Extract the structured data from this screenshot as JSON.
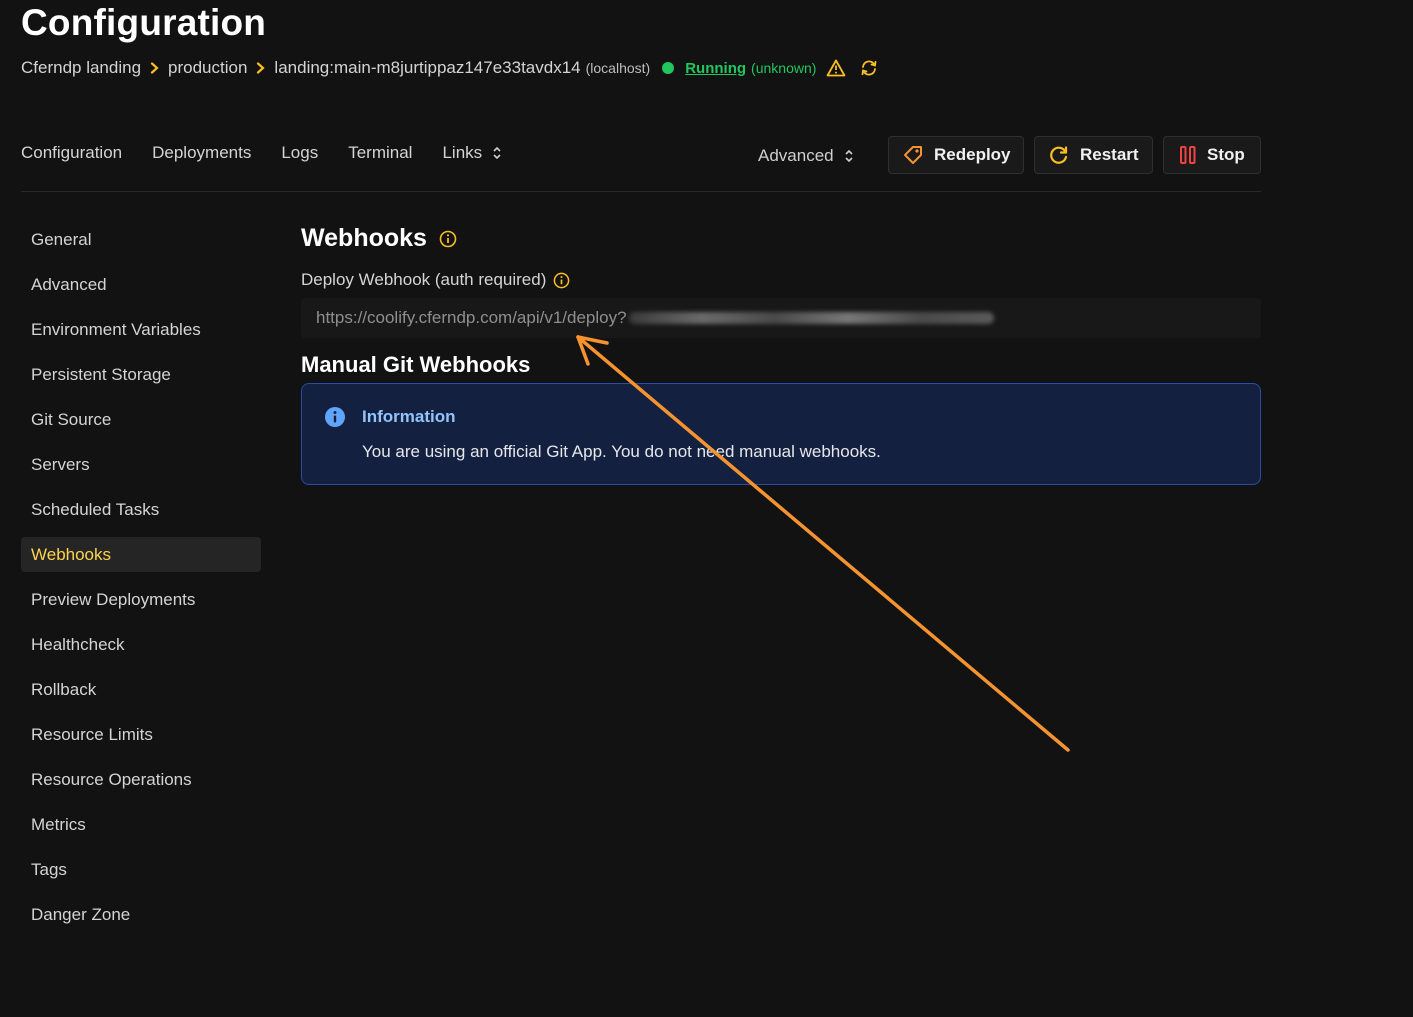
{
  "page": {
    "title": "Configuration"
  },
  "breadcrumb": {
    "project": "Cferndp landing",
    "environment": "production",
    "resource": "landing:main-m8jurtippaz147e33tavdx14",
    "server": "(localhost)",
    "status": "Running",
    "health": "(unknown)"
  },
  "tabs": {
    "configuration": "Configuration",
    "deployments": "Deployments",
    "logs": "Logs",
    "terminal": "Terminal",
    "links": "Links"
  },
  "actions": {
    "advanced": "Advanced",
    "redeploy": "Redeploy",
    "restart": "Restart",
    "stop": "Stop"
  },
  "sidebar": {
    "items": [
      {
        "label": "General"
      },
      {
        "label": "Advanced"
      },
      {
        "label": "Environment Variables"
      },
      {
        "label": "Persistent Storage"
      },
      {
        "label": "Git Source"
      },
      {
        "label": "Servers"
      },
      {
        "label": "Scheduled Tasks"
      },
      {
        "label": "Webhooks",
        "active": true
      },
      {
        "label": "Preview Deployments"
      },
      {
        "label": "Healthcheck"
      },
      {
        "label": "Rollback"
      },
      {
        "label": "Resource Limits"
      },
      {
        "label": "Resource Operations"
      },
      {
        "label": "Metrics"
      },
      {
        "label": "Tags"
      },
      {
        "label": "Danger Zone"
      }
    ]
  },
  "main": {
    "webhooks_title": "Webhooks",
    "deploy_webhook_label": "Deploy Webhook (auth required)",
    "deploy_webhook_url": "https://coolify.cferndp.com/api/v1/deploy?",
    "manual_title": "Manual Git Webhooks",
    "info_title": "Information",
    "info_text": "You are using an official Git App. You do not need manual webhooks."
  },
  "colors": {
    "accent": "#fcd34d",
    "running": "#22c55e",
    "stop": "#ef4444",
    "annotation_arrow": "#f59331",
    "info_bg": "#14203f",
    "info_border": "#2c4ba8"
  }
}
